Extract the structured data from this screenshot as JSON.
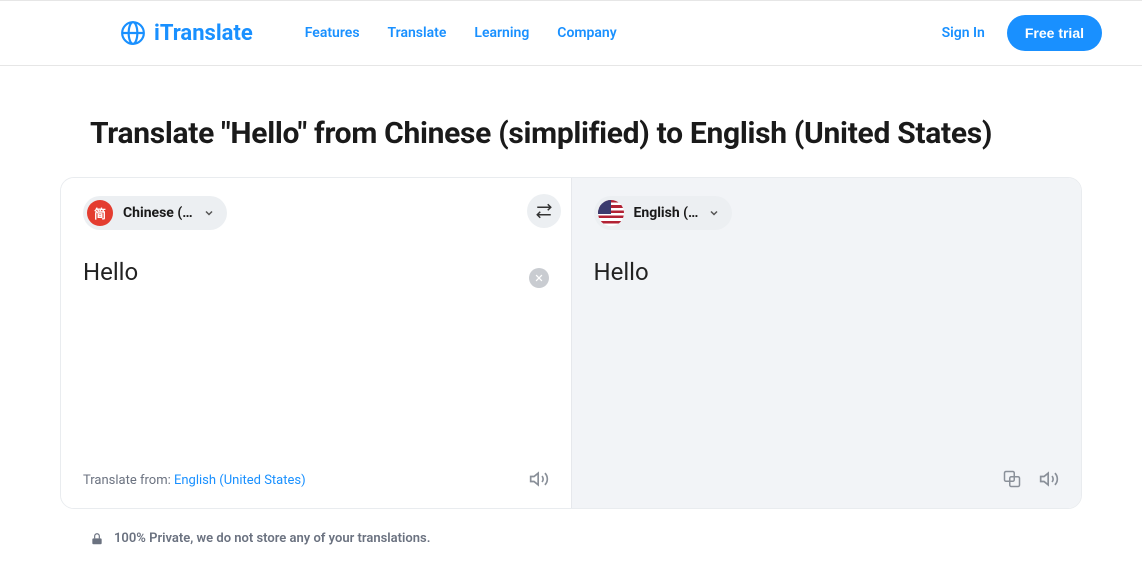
{
  "header": {
    "brand": "iTranslate",
    "nav": [
      "Features",
      "Translate",
      "Learning",
      "Company"
    ],
    "sign_in": "Sign In",
    "cta": "Free trial"
  },
  "page": {
    "title": "Translate \"Hello\" from Chinese (simplified) to English (United States)"
  },
  "source": {
    "flag_glyph": "简",
    "lang_label": "Chinese (…",
    "text": "Hello",
    "detect_prefix": "Translate from: ",
    "detect_lang": "English (United States)"
  },
  "target": {
    "lang_label": "English (…",
    "text": "Hello"
  },
  "privacy": "100% Private, we do not store any of your translations.",
  "colors": {
    "accent": "#1990ff"
  }
}
